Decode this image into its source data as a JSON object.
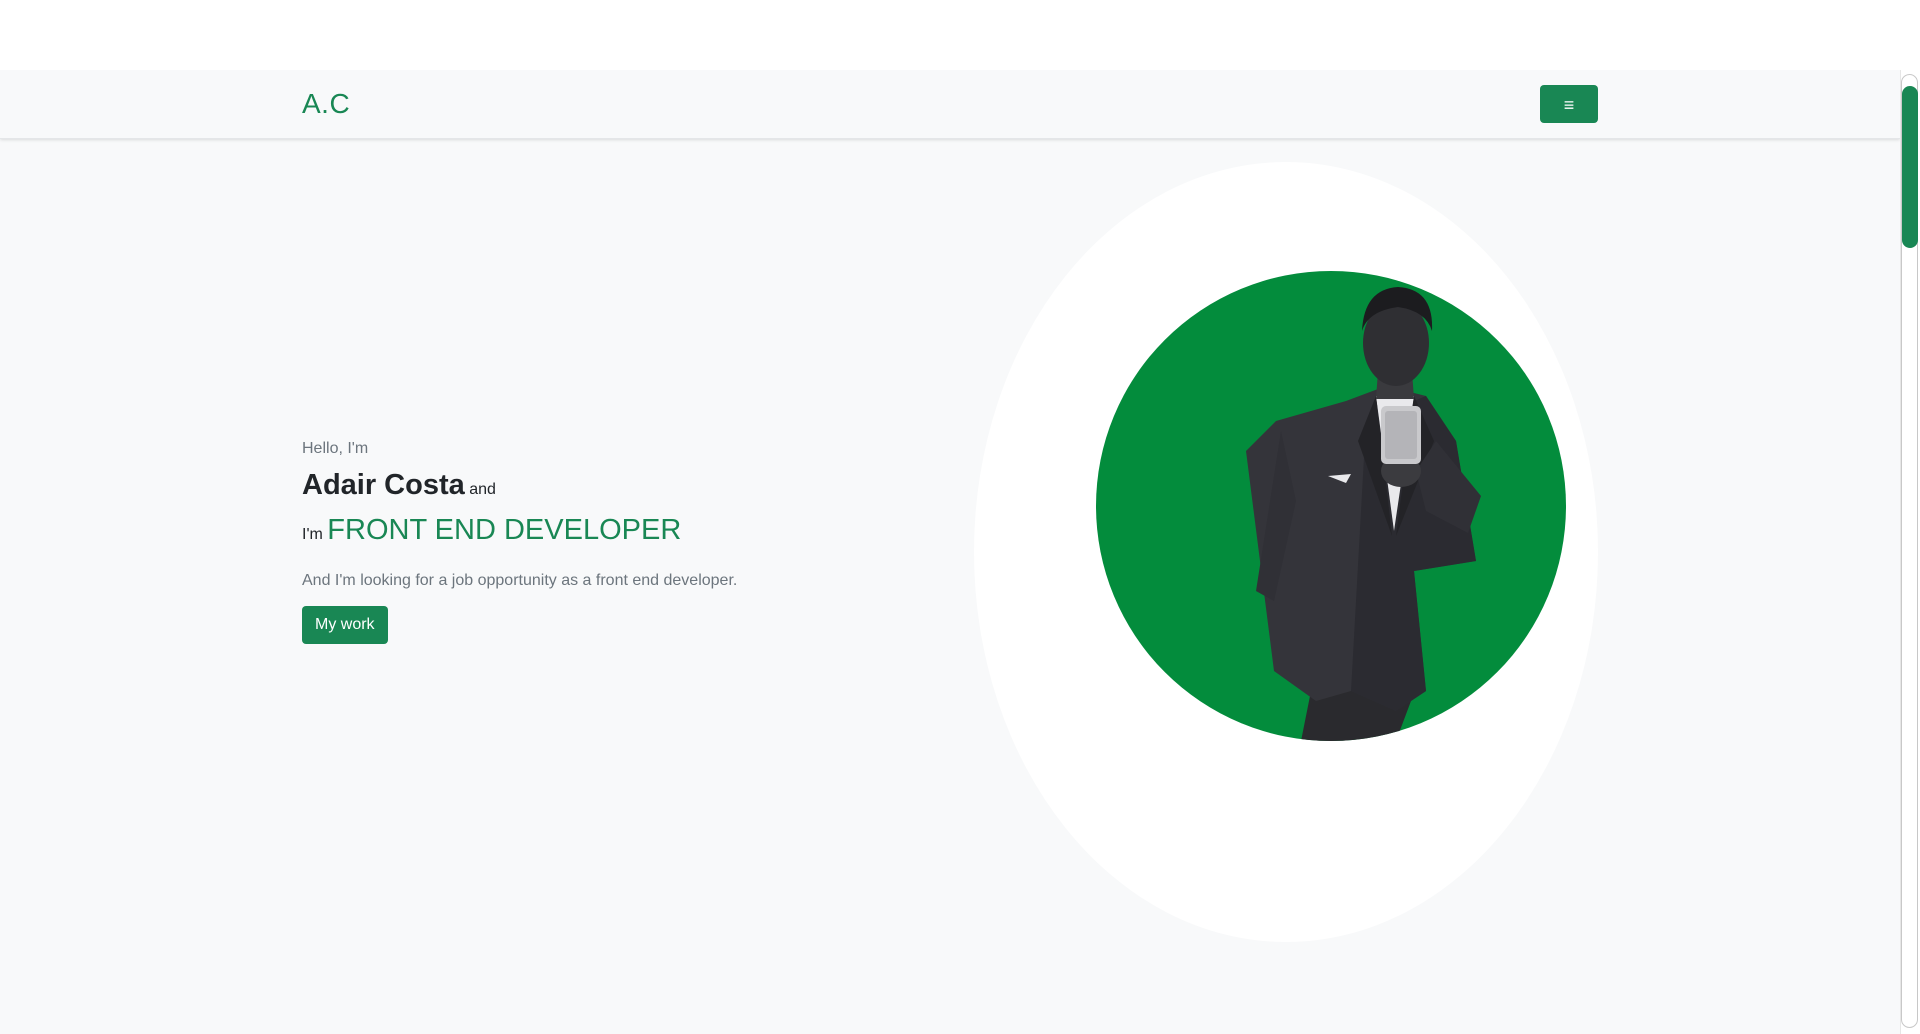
{
  "navbar": {
    "brand": "A.C",
    "menu_icon": "hamburger-menu-icon",
    "menu_glyph": "≡"
  },
  "hero": {
    "greeting": "Hello, I'm",
    "name": "Adair Costa",
    "and_word": "and",
    "im_word": "I'm",
    "role": "FRONT END DEVELOPER",
    "tagline": "And I'm looking for a job opportunity as a front end developer.",
    "cta_label": "My work"
  },
  "portrait": {
    "description_icon": "profile-photo"
  },
  "colors": {
    "accent": "#198754",
    "portrait_bg": "#038c3c",
    "page_bg": "#f8f9fa",
    "muted_text": "#6c757d"
  }
}
